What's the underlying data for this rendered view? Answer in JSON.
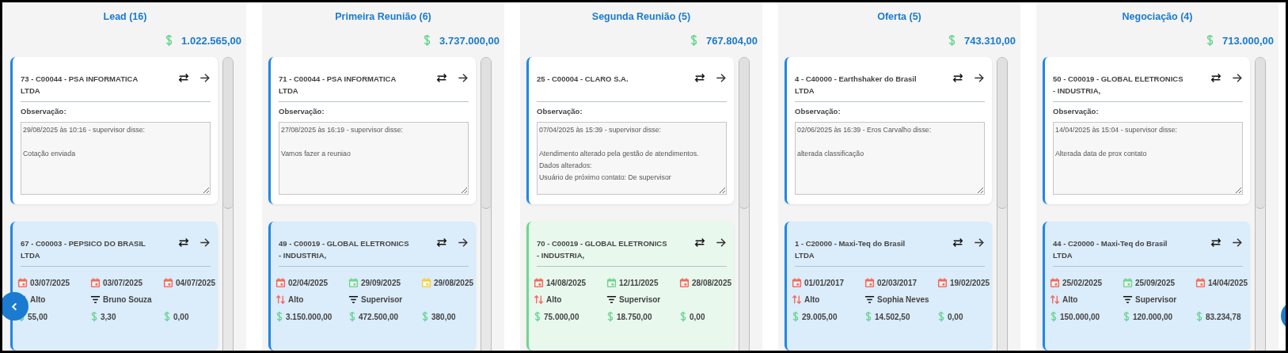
{
  "columns": [
    {
      "title": "Lead (16)",
      "total": "1.022.565,00",
      "cards": [
        {
          "kind": "notes",
          "title": "73 - C00044 - PSA INFORMATICA LTDA",
          "notes_label": "Observação:",
          "notes": "29/08/2025 às 10:16 - supervisor disse:\n\nCotação enviada"
        },
        {
          "kind": "details",
          "color": "#1e88e5",
          "title": "67 - C00003 - PEPSICO DO BRASIL LTDA",
          "dates": [
            {
              "text": "03/07/2025",
              "color": "#f26b5b"
            },
            {
              "text": "03/07/2025",
              "color": "#f26b5b"
            },
            {
              "text": "04/07/2025",
              "color": "#f26b5b"
            }
          ],
          "priority": "Alto",
          "owner": "Bruno Souza",
          "amounts": [
            "55,00",
            "3,30",
            "0,00"
          ]
        }
      ]
    },
    {
      "title": "Primeira Reunião (6)",
      "total": "3.737.000,00",
      "cards": [
        {
          "kind": "notes",
          "title": "71 - C00044 - PSA INFORMATICA LTDA",
          "notes_label": "Observação:",
          "notes": "27/08/2025 às 16:19 - supervisor disse:\n\nVamos fazer a reuniao"
        },
        {
          "kind": "details",
          "color": "#1e88e5",
          "title": "49 - C00019 - GLOBAL ELETRONICS - INDUSTRIA,",
          "dates": [
            {
              "text": "02/04/2025",
              "color": "#f26b5b"
            },
            {
              "text": "29/09/2025",
              "color": "#6fd68e"
            },
            {
              "text": "29/08/2025",
              "color": "#f7cd3d"
            }
          ],
          "priority": "Alto",
          "owner": "Supervisor",
          "amounts": [
            "3.150.000,00",
            "472.500,00",
            "380,00"
          ]
        }
      ]
    },
    {
      "title": "Segunda Reunião (5)",
      "total": "767.804,00",
      "cards": [
        {
          "kind": "notes",
          "title": "25 - C00004 - CLARO S.A.",
          "notes_label": "Observação:",
          "notes": "07/04/2025 às 15:39 - supervisor disse:\n\nAtendimento alterado pela gestão de atendimentos.\nDados alterados:\nUsuário de próximo contato: De supervisor"
        },
        {
          "kind": "details",
          "color": "#6fd68e",
          "title": "70 - C00019 - GLOBAL ELETRONICS - INDUSTRIA,",
          "dates": [
            {
              "text": "14/08/2025",
              "color": "#f26b5b"
            },
            {
              "text": "12/11/2025",
              "color": "#6fd68e"
            },
            {
              "text": "28/08/2025",
              "color": "#f26b5b"
            }
          ],
          "priority": "Alto",
          "owner": "Supervisor",
          "amounts": [
            "75.000,00",
            "18.750,00",
            "0,00"
          ]
        }
      ]
    },
    {
      "title": "Oferta (5)",
      "total": "743.310,00",
      "cards": [
        {
          "kind": "notes",
          "title": "4 - C40000 - Earthshaker do Brasil LTDA",
          "notes_label": "Observação:",
          "notes": "02/06/2025 às 16:39 - Eros Carvalho disse:\n\nalterada classificação"
        },
        {
          "kind": "details",
          "color": "#1e88e5",
          "title": "1 - C20000 - Maxi-Teq do Brasil LTDA",
          "dates": [
            {
              "text": "01/01/2017",
              "color": "#f26b5b"
            },
            {
              "text": "02/03/2017",
              "color": "#f26b5b"
            },
            {
              "text": "19/02/2025",
              "color": "#f26b5b"
            }
          ],
          "priority": "Alto",
          "owner": "Sophia Neves",
          "amounts": [
            "29.005,00",
            "14.502,50",
            "0,00"
          ]
        }
      ]
    },
    {
      "title": "Negociação (4)",
      "total": "713.000,00",
      "cards": [
        {
          "kind": "notes",
          "title": "50 - C00019 - GLOBAL ELETRONICS - INDUSTRIA,",
          "notes_label": "Observação:",
          "notes": "14/04/2025 às 15:04 - supervisor disse:\n\nAlterada data de prox contato"
        },
        {
          "kind": "details",
          "color": "#1e88e5",
          "title": "44 - C20000 - Maxi-Teq do Brasil LTDA",
          "dates": [
            {
              "text": "25/02/2025",
              "color": "#f26b5b"
            },
            {
              "text": "25/09/2025",
              "color": "#6fd68e"
            },
            {
              "text": "14/04/2025",
              "color": "#f26b5b"
            }
          ],
          "priority": "Alto",
          "owner": "Supervisor",
          "amounts": [
            "150.000,00",
            "120.000,00",
            "83.234,78"
          ]
        }
      ]
    }
  ]
}
